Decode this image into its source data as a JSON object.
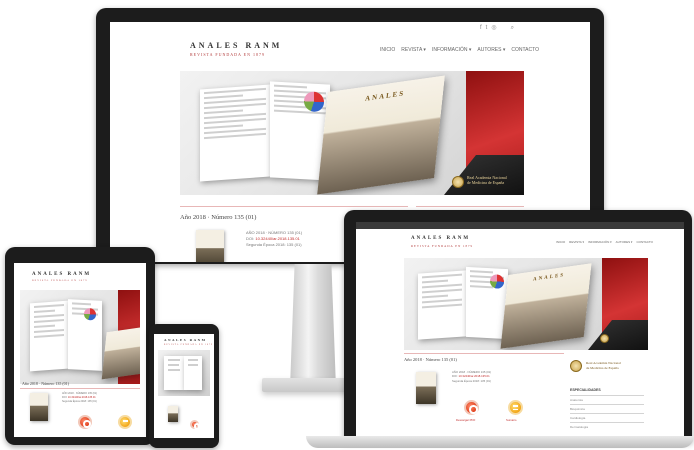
{
  "site": {
    "logo_title": "ANALES RANM",
    "logo_subtitle": "REVISTA FUNDADA EN 1879",
    "nav": [
      "INICIO",
      "REVISTA ▾",
      "INFORMACIÓN ▾",
      "AUTORES ▾",
      "CONTACTO"
    ],
    "social_icons": [
      "facebook-icon",
      "twitter-icon",
      "instagram-icon",
      "search-icon"
    ],
    "issue_title": "Año 2018 · Número 135 (01)",
    "meta_lines": [
      "AÑO 2018 · NÚMERO 135 (01)",
      "DOI: 10.32440/ar.2018.135.01",
      "Segunda Época 2018: 135 (01)"
    ],
    "doi_prefix": "DOI:",
    "doi_link": "10.32440/ar.2018.135.01",
    "pdf_label": "Descargar PDF",
    "summary_label": "Sumario",
    "institution": [
      "Real Academia Nacional",
      "de Medicina de España"
    ],
    "cover_title": "ANALES",
    "sidebar_heading": "ESPECIALIDADES",
    "sidebar_items": [
      "Anatomía",
      "Bioquímica",
      "Cardiología",
      "Dermatología"
    ]
  },
  "colors": {
    "brand_red": "#c02b2b",
    "bezel": "#1c1c1c",
    "accent_line": "#e8b7b7"
  }
}
